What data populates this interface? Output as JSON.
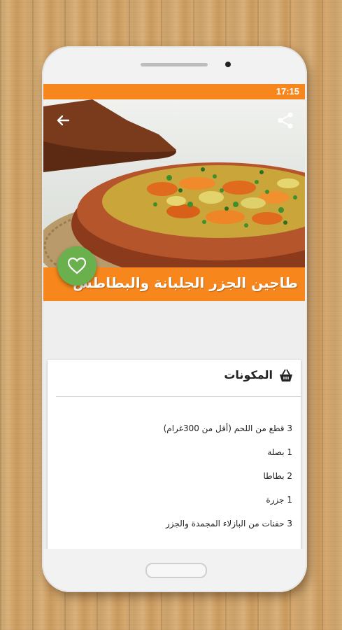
{
  "status": {
    "time": "17:15"
  },
  "recipe": {
    "title": "طاجين الجزر الجلبانة والبطاطس"
  },
  "ingredients": {
    "header": "المكونات",
    "items": [
      "3 قطع من اللحم (أقل من 300غرام)",
      "1 بصلة",
      "2 بطاطا",
      "1 جزرة",
      "3 حفنات من البازلاء المجمدة والجزر"
    ]
  },
  "icons": {
    "back": "back-arrow-icon",
    "share": "share-icon",
    "favorite": "heart-icon",
    "ingredients": "basket-icon"
  },
  "colors": {
    "accent": "#f7871c",
    "favorite": "#6ab04c"
  }
}
